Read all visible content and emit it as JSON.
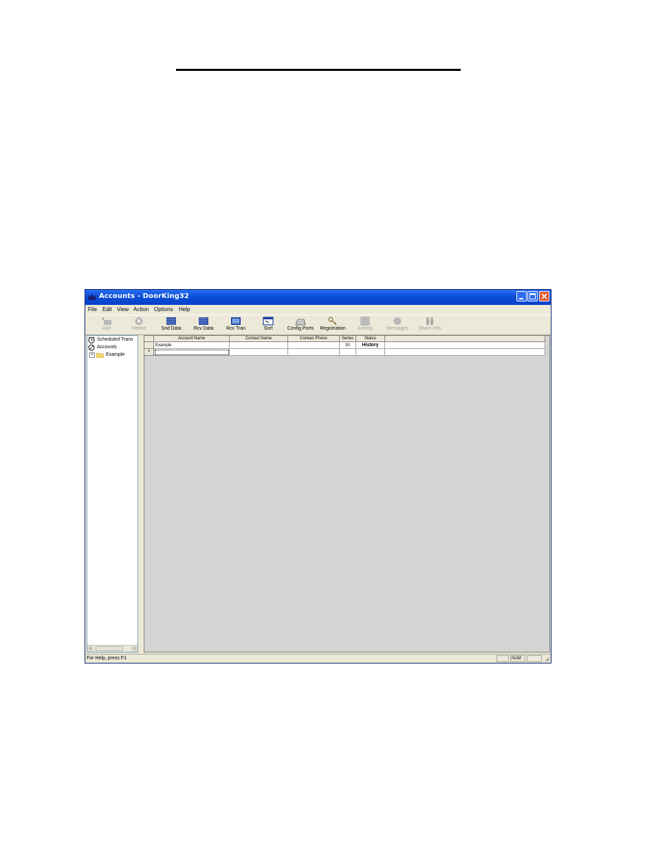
{
  "window": {
    "title": "Accounts  - DoorKing32",
    "title_color": "#0a4fd8"
  },
  "menu": [
    "File",
    "Edit",
    "View",
    "Action",
    "Options",
    "Help"
  ],
  "toolbar": [
    {
      "label": "Add",
      "icon": "add-icon",
      "enabled": false
    },
    {
      "label": "Delete",
      "icon": "delete-icon",
      "enabled": false
    },
    {
      "label": "Snd Data",
      "icon": "send-data-icon",
      "enabled": true
    },
    {
      "label": "Rcv Data",
      "icon": "receive-data-icon",
      "enabled": true
    },
    {
      "label": "Rcv Tran",
      "icon": "receive-transactions-icon",
      "enabled": true
    },
    {
      "label": "Sort",
      "icon": "sort-icon",
      "enabled": true
    },
    {
      "label": "Config Ports",
      "icon": "config-ports-icon",
      "enabled": true
    },
    {
      "label": "Registration",
      "icon": "registration-key-icon",
      "enabled": true
    },
    {
      "label": "Activity",
      "icon": "activity-icon",
      "enabled": false
    },
    {
      "label": "Messages",
      "icon": "messages-icon",
      "enabled": false
    },
    {
      "label": "Share Info",
      "icon": "share-info-icon",
      "enabled": false
    }
  ],
  "tree": [
    {
      "label": "Scheduled Trans",
      "icon": "alarm-clock-icon"
    },
    {
      "label": "Accounts",
      "icon": "accounts-icon"
    },
    {
      "label": "Example",
      "icon": "folder-icon",
      "expander": "+"
    }
  ],
  "grid": {
    "columns": [
      "Account Name",
      "Contact Name",
      "Contact Phone",
      "Series",
      "Status"
    ],
    "rows": [
      {
        "account_name": "Example",
        "contact_name": "",
        "contact_phone": "",
        "series": "30",
        "status": "History"
      }
    ],
    "new_row_marker": "*"
  },
  "status_bar": {
    "message": "For Help, press F1",
    "indicator": "NUM"
  }
}
